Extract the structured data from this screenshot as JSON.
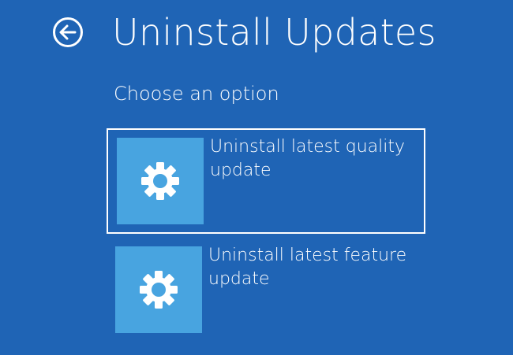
{
  "header": {
    "title": "Uninstall Updates",
    "back_icon": "back-arrow-circle-icon"
  },
  "subtitle": "Choose an option",
  "options": [
    {
      "label": "Uninstall latest quality update",
      "icon": "gear-icon",
      "selected": true
    },
    {
      "label": "Uninstall latest feature update",
      "icon": "gear-icon",
      "selected": false
    }
  ],
  "colors": {
    "background": "#1f64b5",
    "tile": "#48a4e0",
    "text": "#ffffff"
  }
}
